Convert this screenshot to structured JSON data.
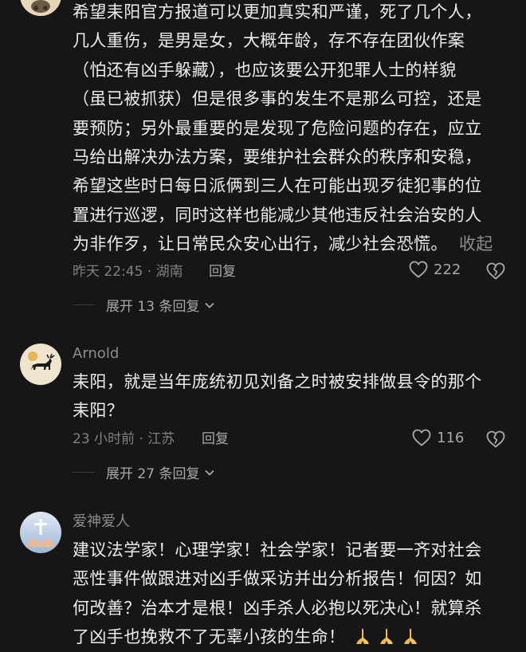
{
  "comments": [
    {
      "lines": [
        "希望耒阳官方报道可以更加真实和严谨，死了几个人，",
        "几人重伤，是男是女，大概年龄，存不存在团伙作案",
        "（怕还有凶手躲藏），也应该要公开犯罪人士的样貌",
        "（虽已被抓获）但是很多事的发生不是那么可控，还是",
        "要预防；另外最重要的是发现了危险问题的存在，应立",
        "马给出解决办法方案，要维护社会群众的秩序和安稳，",
        "希望这些时日每日派俩到三人在可能出现歹徒犯事的位",
        "置进行巡逻，同时这样也能减少其他违反社会治安的人",
        "为非作歹，让日常民众安心出行，减少社会恐慌。"
      ],
      "collapse_label": "收起",
      "time_location": "昨天 22:45 · 湖南",
      "reply_label": "回复",
      "likes": "222",
      "expand_label": "展开 13 条回复"
    },
    {
      "username": "Arnold",
      "lines": [
        "耒阳，就是当年庞统初见刘备之时被安排做县令的那个",
        "耒阳？"
      ],
      "time_location": "23 小时前 · 江苏",
      "reply_label": "回复",
      "likes": "116",
      "expand_label": "展开 27 条回复"
    },
    {
      "username": "爱神爱人",
      "lines": [
        "建议法学家！心理学家！社会学家！记者要一齐对社会",
        "恶性事件做跟进对凶手做采访并出分析报告！何因？如",
        "何改善？治本才是根！凶手杀人必抱以死决心！就算杀",
        "了凶手也挽救不了无辜小孩的生命！"
      ],
      "emoji_icons": [
        "praying-hands-icon",
        "praying-hands-icon",
        "praying-hands-icon"
      ]
    }
  ],
  "colors": {
    "background": "#161616",
    "text": "#ececec",
    "muted": "#808080",
    "action": "#a8a8a8"
  }
}
